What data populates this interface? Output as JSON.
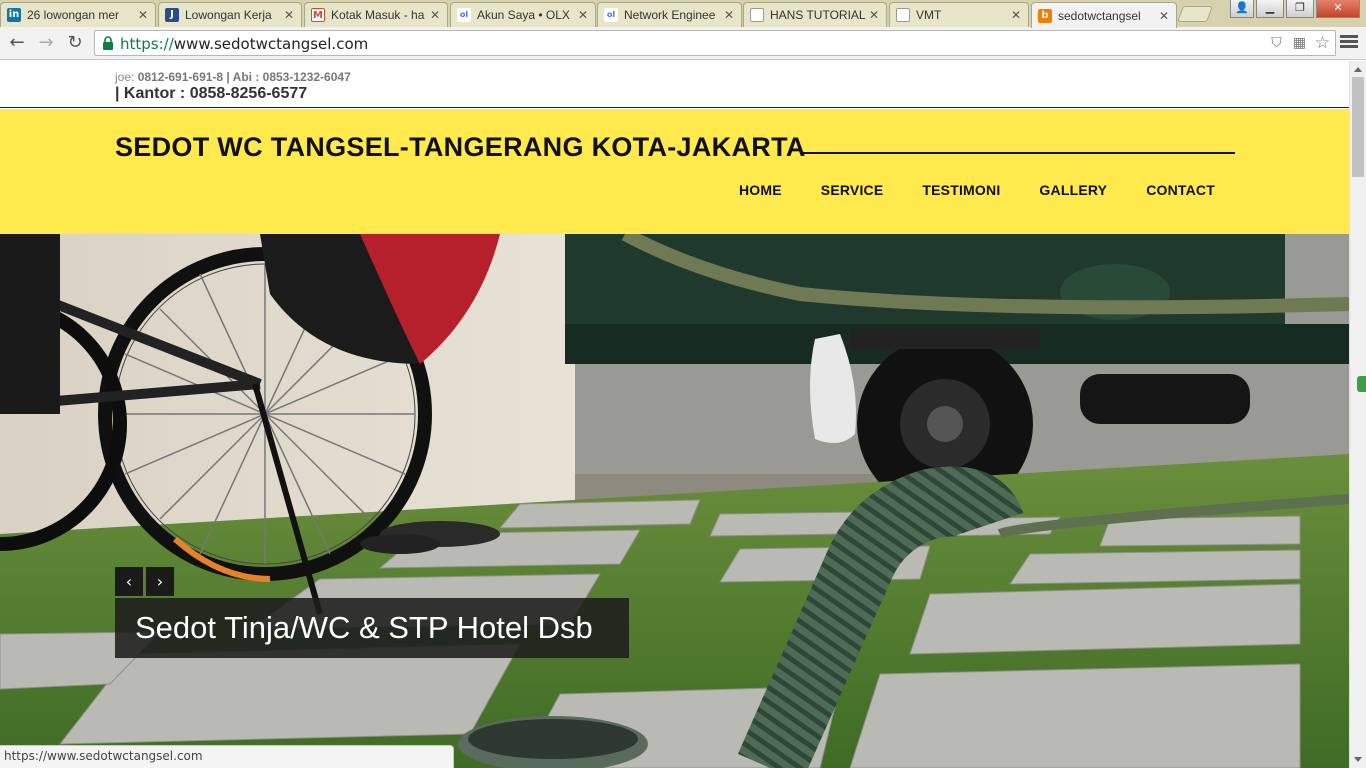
{
  "browser": {
    "tabs": [
      {
        "title": "26 lowongan mer",
        "favicon": "linkedin-icon",
        "color": "#0e76a8",
        "glyph": "in"
      },
      {
        "title": "Lowongan Kerja",
        "favicon": "jobs-icon",
        "color": "#2b4b90",
        "glyph": "J"
      },
      {
        "title": "Kotak Masuk - ha",
        "favicon": "gmail-icon",
        "color": "#d14836",
        "glyph": "M"
      },
      {
        "title": "Akun Saya • OLX",
        "favicon": "olx-icon",
        "color": "#3a77ff",
        "glyph": "ol"
      },
      {
        "title": "Network Enginee",
        "favicon": "olx-icon",
        "color": "#3a77ff",
        "glyph": "ol"
      },
      {
        "title": "HANS TUTORIAL",
        "favicon": "page-icon",
        "color": "#9a9a9a",
        "glyph": ""
      },
      {
        "title": "VMT",
        "favicon": "page-icon",
        "color": "#9a9a9a",
        "glyph": ""
      },
      {
        "title": "sedotwctangsel",
        "favicon": "blogger-icon",
        "color": "#f57d00",
        "glyph": "b"
      }
    ],
    "url_scheme": "https://",
    "url_host": "www.sedotwctangsel.com",
    "status_url": "https://www.sedotwctangsel.com"
  },
  "site": {
    "contacts": {
      "joe_label": "joe: ",
      "joe_number": "0812-691-691-8 | Abi : 0853-1232-6047",
      "kantor": "| Kantor : 0858-8256-6577"
    },
    "brand": "SEDOT WC TANGSEL-TANGERANG KOTA-JAKARTA",
    "nav": [
      "HOME",
      "SERVICE",
      "TESTIMONI",
      "GALLERY",
      "CONTACT"
    ],
    "hero": {
      "caption": "Sedot Tinja/WC & STP Hotel Dsb",
      "prev": "‹",
      "next": "›"
    },
    "colors": {
      "header_bg": "#ffe94d"
    }
  }
}
